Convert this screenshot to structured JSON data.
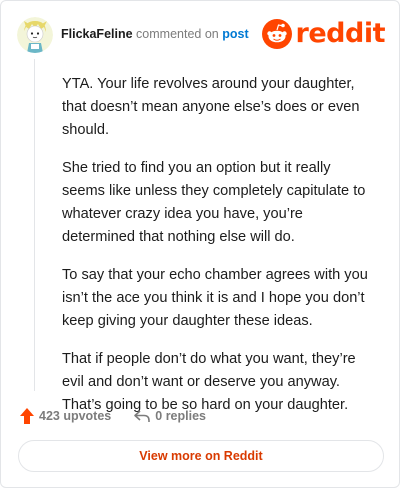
{
  "comment": {
    "author": "FlickaFeline",
    "action_text": "commented on",
    "target_text": "post",
    "paragraphs": [
      "YTA. Your life revolves around your daughter, that doesn’t mean anyone else’s does or even should.",
      "She tried to find you an option but it really seems like unless they completely capitulate to whatever crazy idea you have, you’re determined that nothing else will do.",
      "To say that your echo chamber agrees with you isn’t the ace you think it is and I hope you don’t keep giving your daughter these ideas.",
      "That if people don’t do what you want, they’re evil and don’t want or deserve you anyway. That’s going to be so hard on your daughter."
    ]
  },
  "brand": {
    "wordmark": "reddit",
    "color": "#ff4500"
  },
  "actions": {
    "upvotes": "423 upvotes",
    "replies": "0 replies",
    "upvote_icon": "upvote-arrow-icon",
    "reply_icon": "reply-arrow-icon"
  },
  "footer": {
    "view_more": "View more on Reddit",
    "accent": "#d93a00"
  }
}
